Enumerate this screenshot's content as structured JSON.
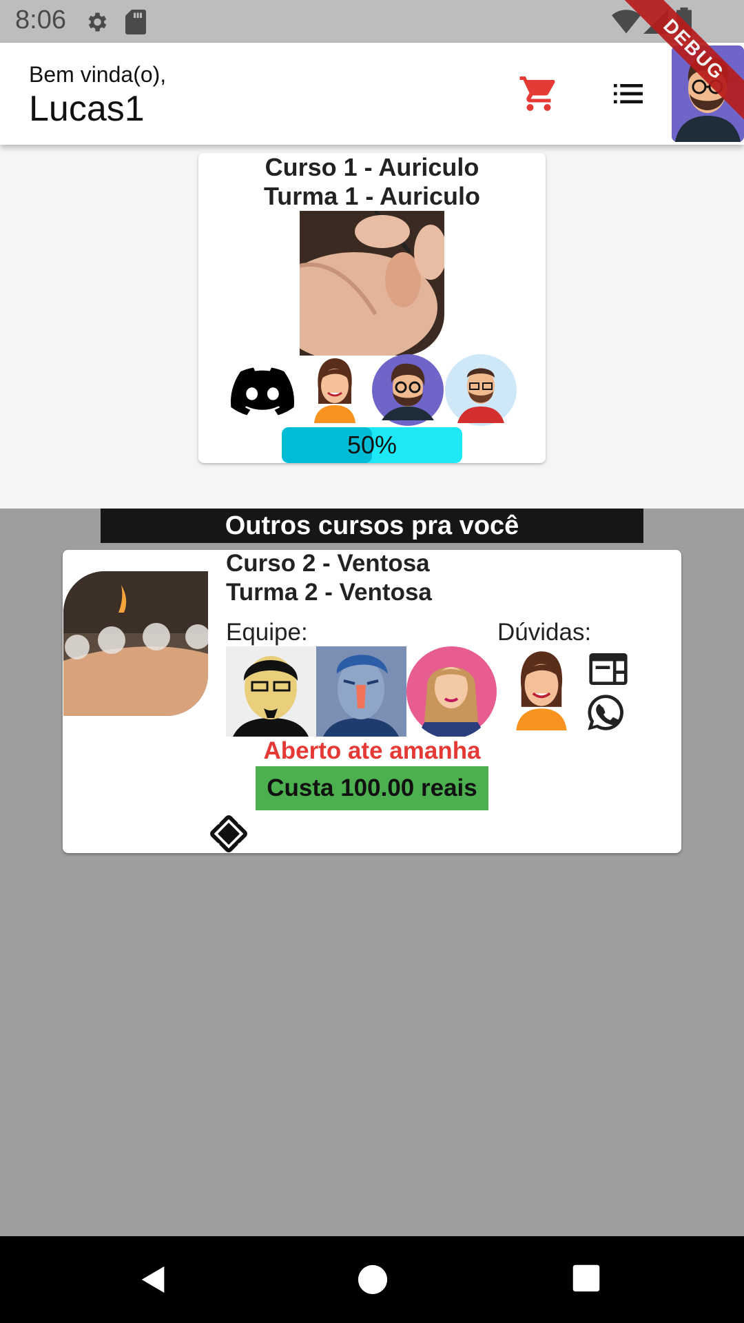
{
  "status_bar": {
    "time": "8:06",
    "icons": [
      "gear-icon",
      "sd-card-icon",
      "wifi-icon",
      "signal-icon",
      "battery-icon"
    ]
  },
  "debug_banner": "DEBUG",
  "header": {
    "greeting": "Bem vinda(o),",
    "username": "Lucas1",
    "icons": [
      "cart-icon",
      "menu-list-icon",
      "profile-avatar"
    ],
    "cart_color": "#e53935"
  },
  "enrolled_course": {
    "course": "Curso 1 - Auriculo",
    "class": "Turma 1 - Auriculo",
    "progress_percent": 50,
    "progress_label": "50%",
    "progress_colors": {
      "fill": "#00bcd4",
      "track": "#1de9f6"
    }
  },
  "other_courses": {
    "header": "Outros cursos pra você",
    "items": [
      {
        "course": "Curso 2 - Ventosa",
        "class": "Turma 2 - Ventosa",
        "team_label": "Equipe:",
        "questions_label": "Dúvidas:",
        "status": "Aberto ate amanha",
        "price": "Custa 100.00 reais",
        "status_color": "#e53935",
        "price_color": "#4caf50"
      }
    ]
  }
}
